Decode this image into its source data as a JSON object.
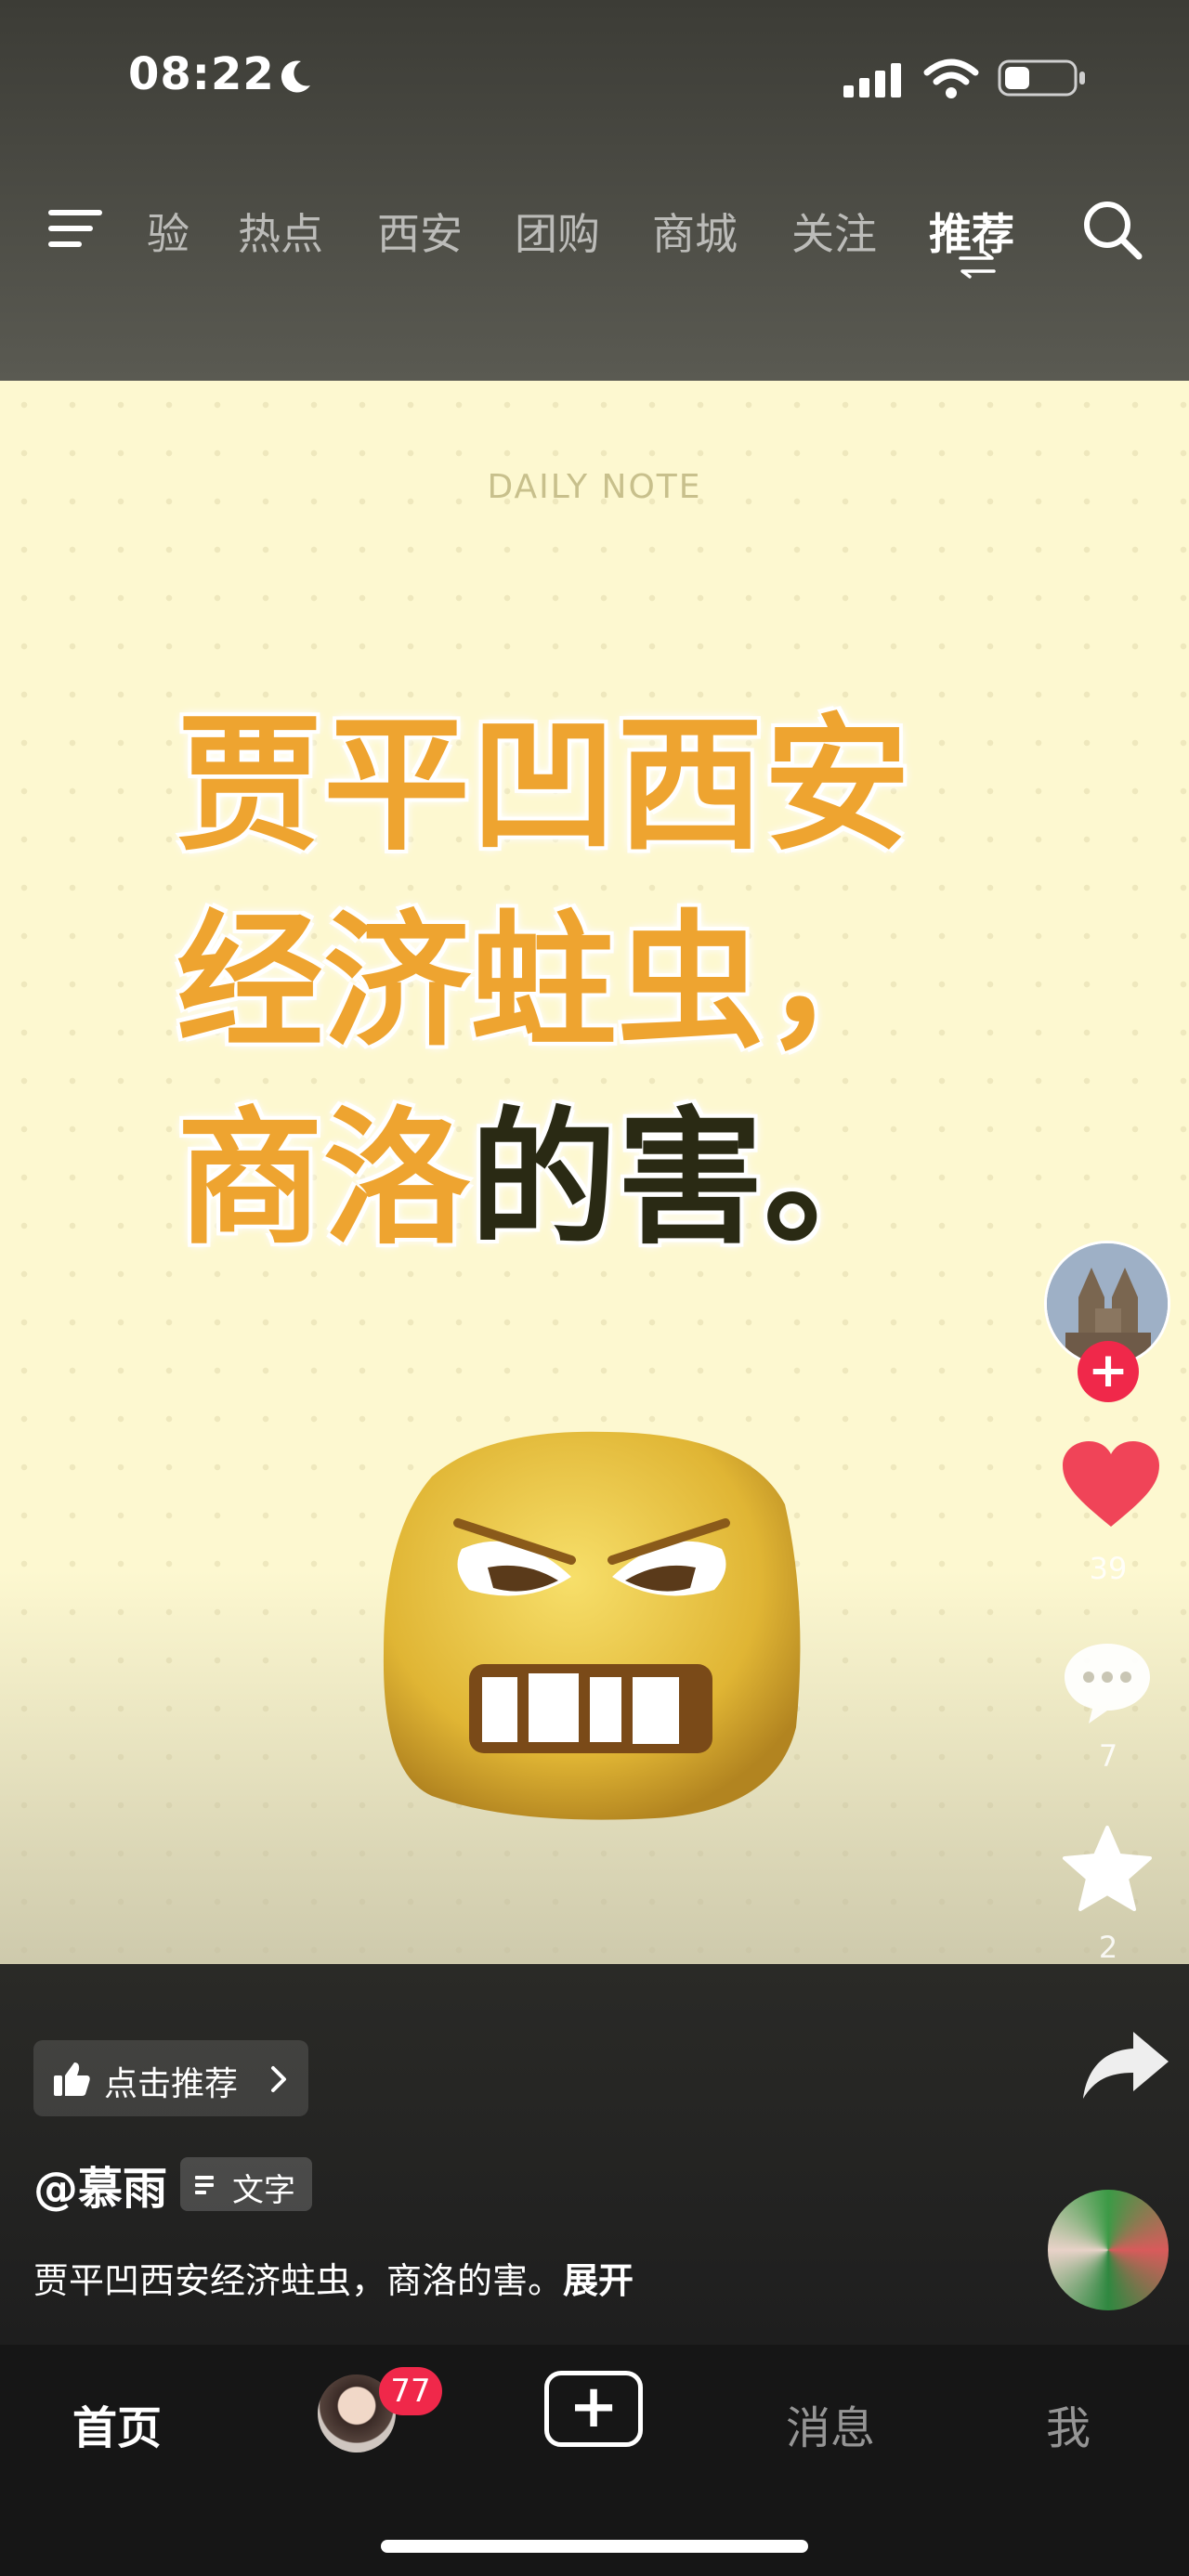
{
  "status_bar": {
    "time": "08:22"
  },
  "top_nav": {
    "tabs": [
      {
        "label": "验",
        "active": false
      },
      {
        "label": "热点",
        "active": false
      },
      {
        "label": "西安",
        "active": false
      },
      {
        "label": "团购",
        "active": false
      },
      {
        "label": "商城",
        "active": false
      },
      {
        "label": "关注",
        "active": false
      },
      {
        "label": "推荐",
        "active": true
      }
    ]
  },
  "post": {
    "header_label": "DAILY NOTE",
    "headline": {
      "line1": "贾平凹西安",
      "line2": "经济蛀虫，",
      "line3_orange": "商洛",
      "line3_dark": "的害。"
    }
  },
  "actions": {
    "likes": "39",
    "comments": "7",
    "favorites": "2"
  },
  "info": {
    "recommend_label": "点击推荐",
    "author": "@慕雨",
    "type_tag": "文字",
    "description": "贾平凹西安经济蛀虫，商洛的害。",
    "expand_label": "展开"
  },
  "tab_bar": {
    "home": "首页",
    "friends_badge": "77",
    "add": "+",
    "messages": "消息",
    "me": "我"
  },
  "colors": {
    "accent_orange": "#eea430",
    "like_red": "#f04458",
    "badge_red": "#f0284a",
    "card_bg": "#fdf8d0"
  }
}
